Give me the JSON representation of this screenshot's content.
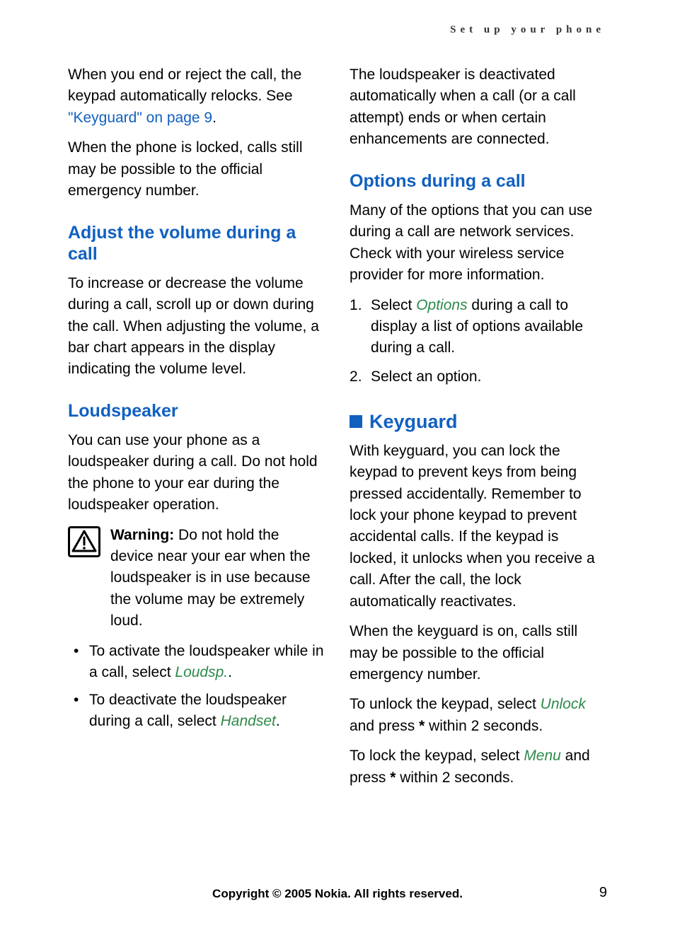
{
  "header": {
    "chapter": "Set up your phone"
  },
  "left": {
    "p1_a": "When you end or reject the call, the keypad automatically relocks. See ",
    "p1_link": "\"Keyguard\" on page 9",
    "p1_b": ".",
    "p2": "When the phone is locked, calls still may be possible to the official emergency number.",
    "h_volume": "Adjust the volume during a call",
    "p_volume": "To increase or decrease the volume during a call, scroll up or down during the call. When adjusting the volume, a bar chart appears in the display indicating the volume level.",
    "h_loud": "Loudspeaker",
    "p_loud1": "You can use your phone as a loudspeaker during a call. Do not hold the phone to your ear during the loudspeaker operation.",
    "warn_label": "Warning:",
    "warn_text": " Do not hold the device near your ear when the loudspeaker is in use because the volume may be extremely loud.",
    "bullets": {
      "b1a": "To activate the loudspeaker while in a call, select ",
      "b1_green": "Loudsp.",
      "b1b": ".",
      "b2a": "To deactivate the loudspeaker during a call, select ",
      "b2_green": "Handset",
      "b2b": "."
    }
  },
  "right": {
    "p_loud2": "The loudspeaker is deactivated automatically when a call (or a call attempt) ends or when certain enhancements are connected.",
    "h_opts": "Options during a call",
    "p_opts1": "Many of the options that you can use during a call are network services. Check with your wireless service provider for more information.",
    "opts": {
      "o1a": "Select ",
      "o1_green": "Options",
      "o1b": " during a call to display a list of options available during a call.",
      "o2": "Select an option."
    },
    "h_key": "Keyguard",
    "p_key1": "With keyguard, you can lock the keypad to prevent keys from being pressed accidentally. Remember to lock your phone keypad to prevent accidental calls. If the keypad is locked, it unlocks when you receive a call. After the call, the lock automatically reactivates.",
    "p_key2": "When the keyguard is on, calls still may be possible to the official emergency number.",
    "p_key3a": "To unlock the keypad, select ",
    "p_key3_green": "Unlock",
    "p_key3b": " and press ",
    "p_key3c": "*",
    "p_key3d": " within 2 seconds.",
    "p_key4a": "To lock the keypad, select ",
    "p_key4_green": "Menu",
    "p_key4b": " and press ",
    "p_key4c": "*",
    "p_key4d": " within 2 seconds."
  },
  "footer": {
    "copyright": "Copyright © 2005 Nokia. All rights reserved.",
    "page": "9"
  }
}
